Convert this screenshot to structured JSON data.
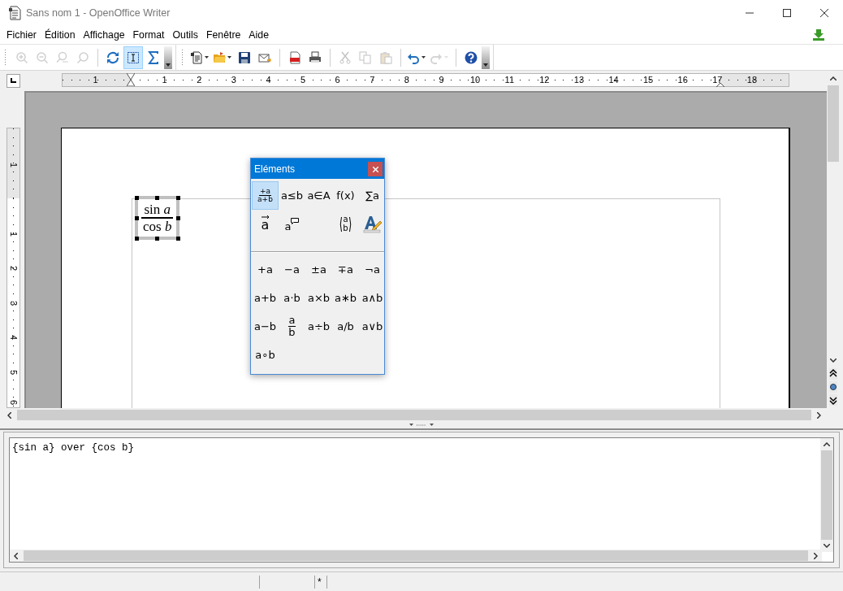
{
  "window": {
    "title": "Sans nom 1 - OpenOffice Writer"
  },
  "menu": [
    "Fichier",
    "Édition",
    "Affichage",
    "Format",
    "Outils",
    "Fenêtre",
    "Aide"
  ],
  "toolbars": [
    {
      "items": [
        {
          "kind": "button",
          "disabled": true,
          "selected": false
        },
        {
          "kind": "button",
          "disabled": true,
          "selected": false
        },
        {
          "kind": "button",
          "disabled": true,
          "selected": false
        },
        {
          "kind": "button",
          "disabled": true,
          "selected": false
        },
        {
          "kind": "separator"
        },
        {
          "kind": "button",
          "disabled": false,
          "selected": false
        },
        {
          "kind": "button",
          "disabled": false,
          "selected": true
        },
        {
          "kind": "button",
          "disabled": false,
          "selected": false
        },
        {
          "kind": "overflow"
        }
      ]
    },
    {
      "items": [
        {
          "kind": "dropdown",
          "disabled": false,
          "selected": false
        },
        {
          "kind": "dropdown",
          "disabled": false,
          "selected": false
        },
        {
          "kind": "button",
          "disabled": false,
          "selected": false
        },
        {
          "kind": "button",
          "disabled": false,
          "selected": false
        },
        {
          "kind": "separator"
        },
        {
          "kind": "button",
          "disabled": false,
          "selected": false
        },
        {
          "kind": "button",
          "disabled": false,
          "selected": false
        },
        {
          "kind": "separator"
        },
        {
          "kind": "button",
          "disabled": true,
          "selected": false
        },
        {
          "kind": "button",
          "disabled": true,
          "selected": false
        },
        {
          "kind": "button",
          "disabled": true,
          "selected": false
        },
        {
          "kind": "separator"
        },
        {
          "kind": "dropdown",
          "disabled": false,
          "selected": false
        },
        {
          "kind": "dropdown",
          "disabled": true,
          "selected": false
        },
        {
          "kind": "separator"
        },
        {
          "kind": "button",
          "disabled": false,
          "selected": false
        },
        {
          "kind": "overflow"
        }
      ]
    }
  ],
  "ruler": {
    "labels": [
      "1",
      "1",
      "2",
      "3",
      "4",
      "5",
      "6",
      "7",
      "8",
      "9",
      "10",
      "11",
      "12",
      "13",
      "14",
      "15",
      "16",
      "17",
      "18"
    ]
  },
  "vertical_ruler": {
    "labels": [
      "1",
      "1",
      "2",
      "3",
      "4",
      "5",
      "6"
    ]
  },
  "formula": {
    "numerator": "sin *a*",
    "denominator": "cos *b*",
    "selected": true
  },
  "elements_panel": {
    "title": "Eléments",
    "categories": [
      {
        "kind": "fraction",
        "top": "+a",
        "bottom": "a+b",
        "selected": true
      },
      {
        "kind": "text",
        "label": "a≤b",
        "selected": false
      },
      {
        "kind": "text",
        "label": "a∈A",
        "selected": false
      },
      {
        "kind": "text",
        "label": "f(x)",
        "selected": false
      },
      {
        "kind": "text",
        "label": "∑a",
        "selected": false
      },
      {
        "kind": "vector",
        "label": "a",
        "selected": false
      },
      {
        "kind": "attribute",
        "label": "a",
        "selected": false
      },
      {
        "kind": "binomial",
        "top": "a",
        "bottom": "b",
        "selected": false
      },
      {
        "kind": "format",
        "selected": false
      }
    ],
    "elements": [
      {
        "kind": "text",
        "label": "+a"
      },
      {
        "kind": "text",
        "label": "−a"
      },
      {
        "kind": "text",
        "label": "±a"
      },
      {
        "kind": "text",
        "label": "∓a"
      },
      {
        "kind": "text",
        "label": "¬a"
      },
      {
        "kind": "text",
        "label": "a+b"
      },
      {
        "kind": "text",
        "label": "a⋅b"
      },
      {
        "kind": "text",
        "label": "a×b"
      },
      {
        "kind": "text",
        "label": "a∗b"
      },
      {
        "kind": "text",
        "label": "a∧b"
      },
      {
        "kind": "text",
        "label": "a−b"
      },
      {
        "kind": "fraction",
        "top": "a",
        "bottom": "b"
      },
      {
        "kind": "text",
        "label": "a÷b"
      },
      {
        "kind": "text",
        "label": "a/b"
      },
      {
        "kind": "text",
        "label": "a∨b"
      },
      {
        "kind": "text",
        "label": "a∘b"
      }
    ]
  },
  "command": {
    "value": "{sin a} over {cos b}"
  },
  "status_bar": {
    "modified": "*"
  }
}
